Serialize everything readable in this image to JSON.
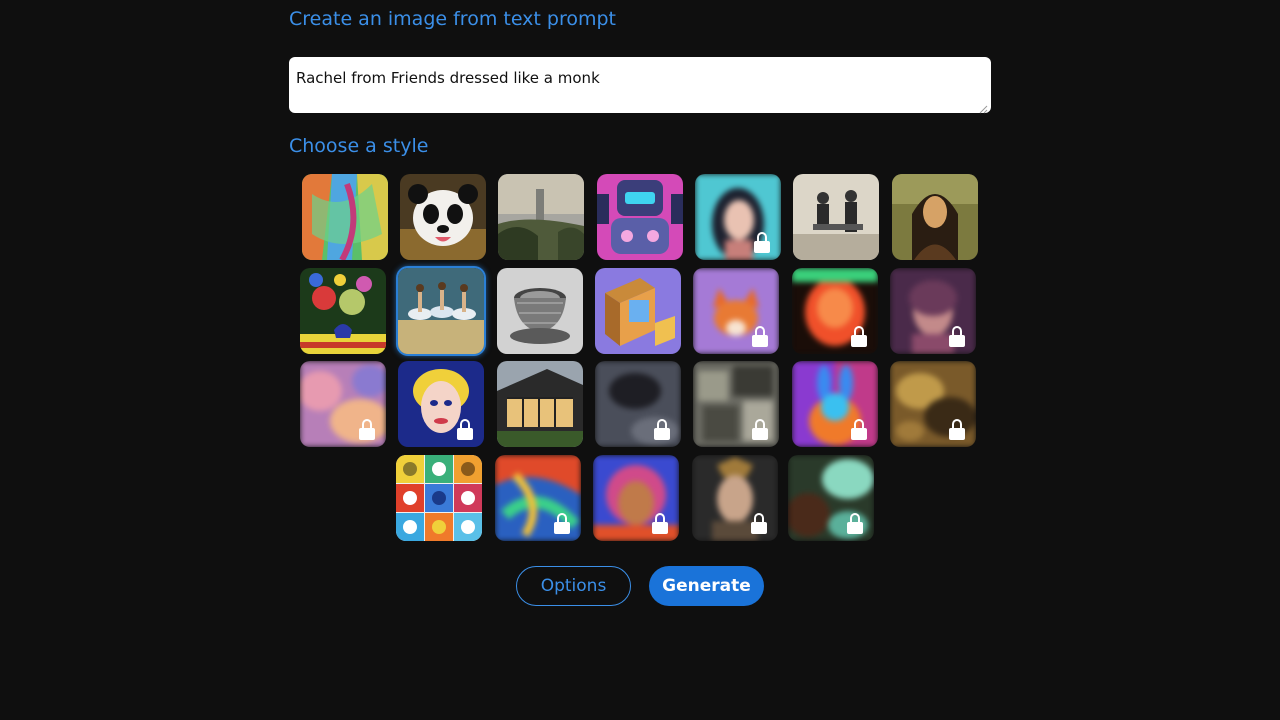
{
  "header": {
    "create_title": "Create an image from text prompt",
    "style_title": "Choose a style"
  },
  "prompt": {
    "value": "Rachel from Friends dressed like a monk"
  },
  "styles": [
    {
      "name": "abstract-painting",
      "locked": false
    },
    {
      "name": "panda",
      "locked": false
    },
    {
      "name": "landscape",
      "locked": false
    },
    {
      "name": "robot",
      "locked": false
    },
    {
      "name": "portrait-anime",
      "locked": true
    },
    {
      "name": "vintage-engraving",
      "locked": false
    },
    {
      "name": "mona-lisa",
      "locked": false
    },
    {
      "name": "flowers",
      "locked": false
    },
    {
      "name": "ballet-dancers",
      "locked": false,
      "selected": true
    },
    {
      "name": "sketch-cup",
      "locked": false
    },
    {
      "name": "isometric",
      "locked": false
    },
    {
      "name": "fox",
      "locked": true
    },
    {
      "name": "neon-face",
      "locked": true
    },
    {
      "name": "soft-portrait",
      "locked": true
    },
    {
      "name": "pastel-clouds",
      "locked": true
    },
    {
      "name": "pop-art",
      "locked": false
    },
    {
      "name": "architecture",
      "locked": false
    },
    {
      "name": "dark-abstract",
      "locked": true
    },
    {
      "name": "cubist",
      "locked": true
    },
    {
      "name": "rainbow-rabbit",
      "locked": true
    },
    {
      "name": "golden-texture",
      "locked": true
    },
    {
      "name": "icon-grid",
      "locked": false
    },
    {
      "name": "fluid-colors",
      "locked": true
    },
    {
      "name": "colorful-portrait",
      "locked": true
    },
    {
      "name": "warrior",
      "locked": true
    },
    {
      "name": "teal-texture",
      "locked": true
    }
  ],
  "actions": {
    "options_label": "Options",
    "generate_label": "Generate"
  },
  "colors": {
    "accent": "#3b8fe8",
    "primary_button": "#1a73d9",
    "background": "#0f0f0f"
  }
}
